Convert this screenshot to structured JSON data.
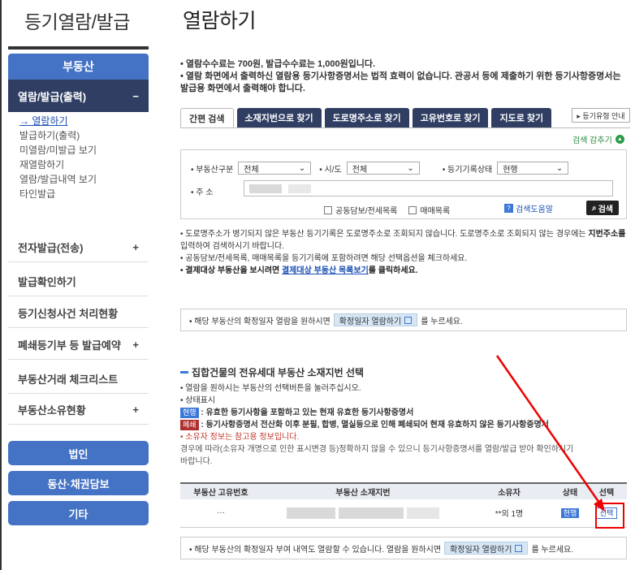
{
  "left": {
    "title": "등기열람/발급",
    "section_label": "부동산",
    "open_menu": "열람/발급(출력)",
    "open_menu_toggle": "−",
    "submenu": [
      "→ 열람하기",
      "발급하기(출력)",
      "미열람/미발급 보기",
      "재열람하기",
      "열람/발급내역 보기",
      "타인발급"
    ],
    "menu_items": [
      {
        "label": "전자발급(전송)",
        "toggle": "+"
      },
      {
        "label": "발급확인하기",
        "toggle": ""
      },
      {
        "label": "등기신청사건 처리현황",
        "toggle": ""
      },
      {
        "label": "폐쇄등기부 등 발급예약",
        "toggle": "+"
      },
      {
        "label": "부동산거래 체크리스트",
        "toggle": ""
      },
      {
        "label": "부동산소유현황",
        "toggle": "+"
      }
    ],
    "buttons": [
      "법인",
      "동산·채권담보",
      "기타"
    ]
  },
  "main": {
    "title": "열람하기",
    "notes": [
      "• 열람수수료는 700원, 발급수수료는 1,000원입니다.",
      "• 열람 화면에서 출력하신 열람용 등기사항증명서는 법적 효력이 없습니다. 관공서 등에 제출하기 위한 등기사항증명서는",
      "발급용 화면에서 출력해야 합니다."
    ],
    "tabs": [
      "간편 검색",
      "소재지번으로 찾기",
      "도로명주소로 찾기",
      "고유번호로 찾기",
      "지도로 찾기"
    ],
    "guide_btn": "▸ 등기유형 안내",
    "hide_search": "검색 감추기",
    "hide_icon": "▲",
    "search": {
      "property_type_label": "• 부동산구분",
      "property_type_value": "전체",
      "city_label": "• 시/도",
      "city_value": "전체",
      "record_status_label": "• 등기기록상태",
      "record_status_value": "현행",
      "address_label": "• 주 소",
      "chk_joint": "공동담보/전세목록",
      "chk_trade": "매매목록",
      "help": "검색도움말",
      "search_btn": "검색"
    },
    "bullets": [
      "• 도로명주소가 병기되지 않은 부동산 등기기록은 도로명주소로 조회되지 않습니다. 도로명주소로 조회되지 않는 경우에는 ",
      "지번주소를",
      "입력하여 검색하시기 바랍니다.",
      "• 공동담보/전세목록, 매매목록을 등기기록에 포함하려면 해당 선택옵션을 체크하세요.",
      "• 결제대상 부동산을 보시려면 ",
      "결제대상 부동산 목록보기",
      "를 클릭하세요."
    ],
    "confirm_pre": "• 해당 부동산의 확정일자 열람을 원하시면",
    "confirm_btn": "확정일자 열람하기",
    "confirm_post": "를 누르세요.",
    "section_title": "집합건물의 전유세대 부동산 소재지번 선택",
    "sec_notes": {
      "n1": "• 열람을 원하시는 부동산의 선택버튼을 눌러주십시오.",
      "n2": "• 상태표시",
      "tag_current": "현행",
      "tag_current_text": ": 유효한 등기사항을 포함하고 있는 현재 유효한 등기사항증명서",
      "tag_closed": "폐쇄",
      "tag_closed_text": ": 등기사항증명서 전산화 이후 분필, 합병, 멸실등으로 인해 폐쇄되어 현재 유효하지 않은 등기사항증명서",
      "n3": "• 소유자 정보는 참고용 정보입니다.",
      "n4": "경우에 따라(소유자 개명으로 인한 표시변경 등)정확하지 않을 수 있으니 등기사항증명서를 열람/발급 받아 확인하시기",
      "n5": "바랍니다."
    },
    "table": {
      "headers": [
        "부동산 고유번호",
        "부동산 소재지번",
        "소유자",
        "상태",
        "선택"
      ],
      "row": {
        "id": "···",
        "owner": "**외 1명",
        "status": "현행",
        "select": "선택"
      }
    },
    "bottom_pre": "• 해당 부동산의 확정일자 부여 내역도 열람할 수 있습니다. 열람을 원하시면",
    "bottom_btn": "확정일자 열람하기",
    "bottom_post": "를 누르세요."
  },
  "colors": {
    "primary": "#4472c4",
    "dark_nav": "#2f3e62",
    "annotation_red": "#e00000"
  }
}
